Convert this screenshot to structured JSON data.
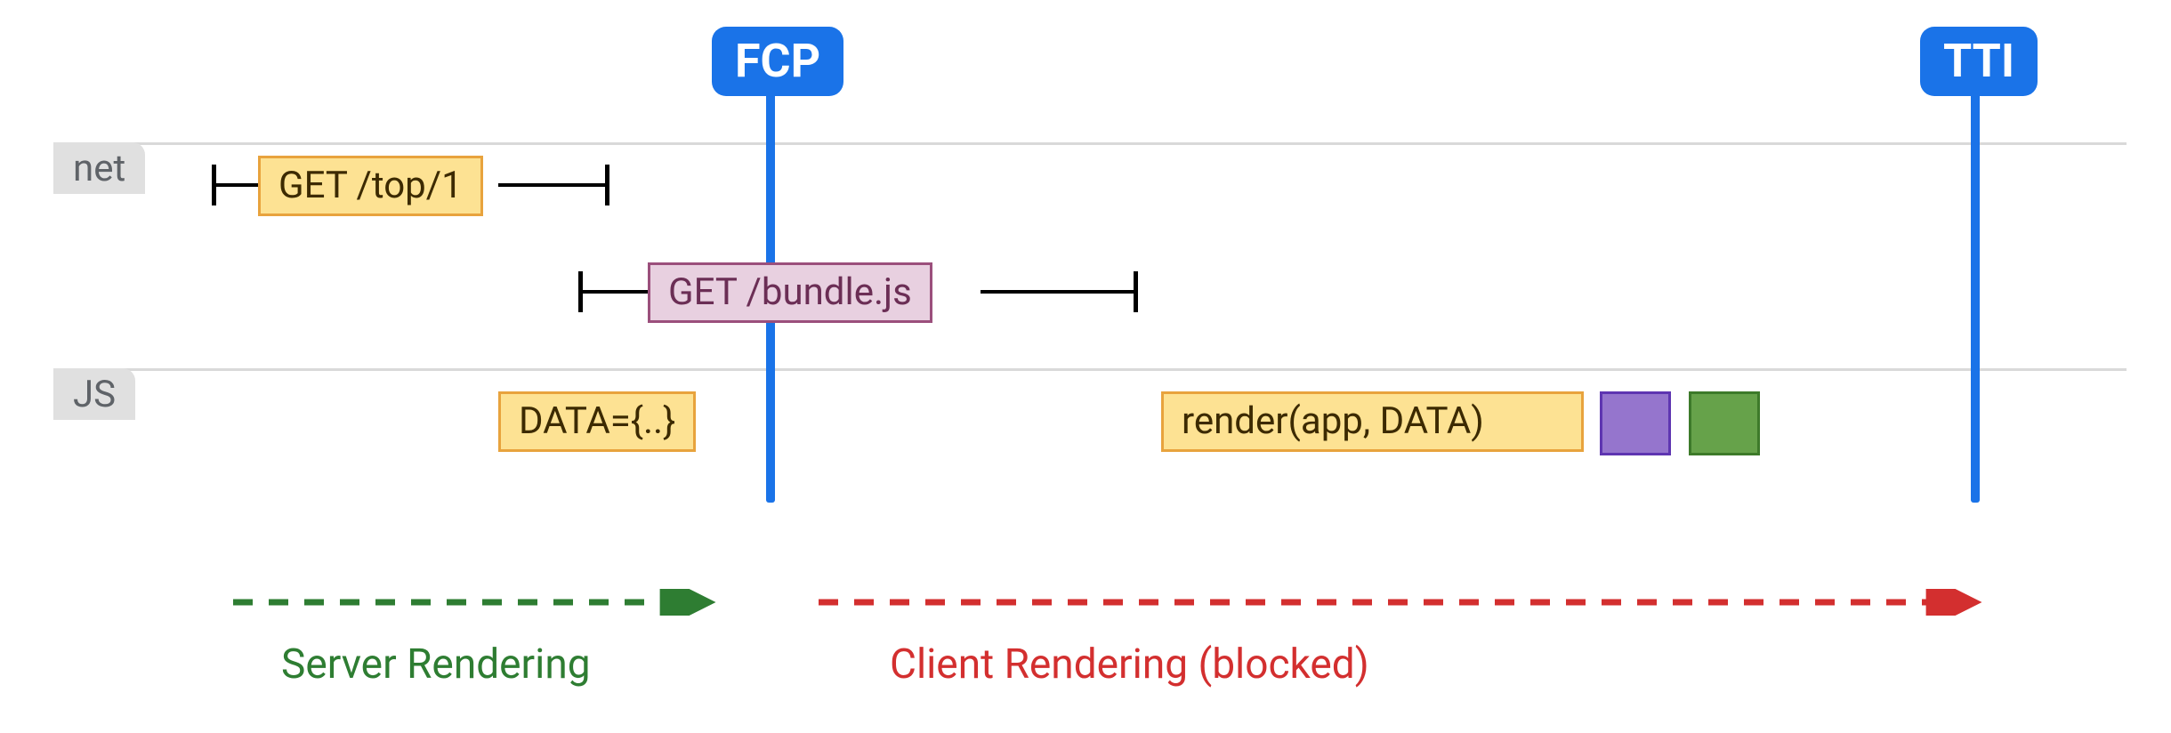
{
  "markers": {
    "fcp": {
      "label": "FCP",
      "x_pct": 35.5
    },
    "tti": {
      "label": "TTI",
      "x_pct": 91.0
    }
  },
  "tracks": {
    "net": {
      "label": "net"
    },
    "js": {
      "label": "JS"
    }
  },
  "spans": {
    "get_top": {
      "label": "GET /top/1"
    },
    "get_bundle": {
      "label": "GET /bundle.js"
    },
    "data_blob": {
      "label": "DATA={..}"
    },
    "render": {
      "label": "render(app, DATA)"
    }
  },
  "phases": {
    "server": {
      "label": "Server Rendering"
    },
    "client": {
      "label": "Client Rendering (blocked)"
    }
  },
  "colors": {
    "marker_blue": "#1a73e8",
    "bar_yellow_fill": "#fde293",
    "bar_yellow_border": "#e8a33d",
    "bar_pink_fill": "#e8d0e0",
    "bar_pink_border": "#9b4f7c",
    "box_purple_fill": "#9575cd",
    "box_purple_border": "#5e35b1",
    "box_green_fill": "#66a24a",
    "box_green_border": "#3d7a2a",
    "arrow_green": "#2e7d32",
    "arrow_red": "#d32f2f",
    "grid_line": "#d9d9d9",
    "track_label_bg": "#e0e0e0"
  }
}
